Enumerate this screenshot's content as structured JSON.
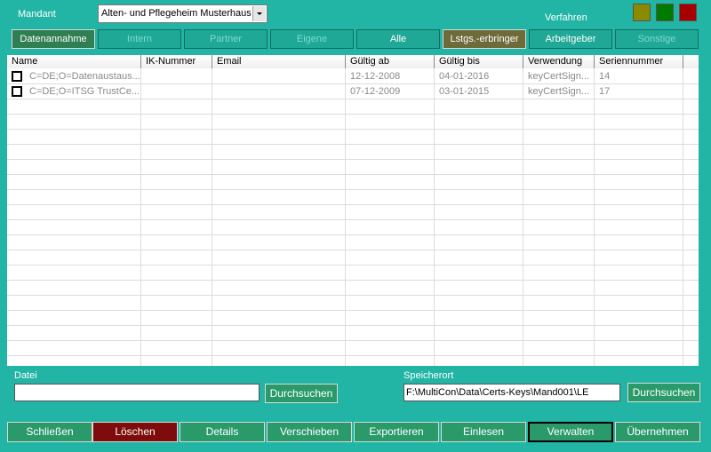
{
  "header": {
    "mandant_label": "Mandant",
    "mandant_value": "Alten- und Pflegeheim Musterhaus",
    "verfahren_label": "Verfahren",
    "status_colors": [
      "#8a8a00",
      "#007a00",
      "#a80000"
    ]
  },
  "filters": [
    {
      "label": "Datenannahme",
      "state": "active"
    },
    {
      "label": "Intern",
      "state": "disabled"
    },
    {
      "label": "Partner",
      "state": "disabled"
    },
    {
      "label": "Eigene",
      "state": "disabled"
    },
    {
      "label": "Alle",
      "state": "normal"
    },
    {
      "label": "Lstgs.-erbringer",
      "state": "selected"
    },
    {
      "label": "Arbeitgeber",
      "state": "normal"
    },
    {
      "label": "Sonstige",
      "state": "disabled"
    }
  ],
  "table": {
    "columns": [
      "Name",
      "IK-Nummer",
      "Email",
      "Gültig ab",
      "Gültig bis",
      "Verwendung",
      "Seriennummer"
    ],
    "rows": [
      {
        "name": "C=DE;O=Datenaustaus...",
        "ik": "",
        "email": "",
        "valid_from": "12-12-2008",
        "valid_to": "04-01-2016",
        "usage": "keyCertSign...",
        "serial": "14"
      },
      {
        "name": "C=DE;O=ITSG TrustCe...",
        "ik": "",
        "email": "",
        "valid_from": "07-12-2009",
        "valid_to": "03-01-2015",
        "usage": "keyCertSign...",
        "serial": "17"
      }
    ]
  },
  "datei": {
    "label": "Datei",
    "value": "",
    "button": "Durchsuchen"
  },
  "speicherort": {
    "label": "Speicherort",
    "value": "F:\\MultiCon\\Data\\Certs-Keys\\Mand001\\LE",
    "button": "Durchsuchen"
  },
  "actions": [
    {
      "label": "Schließen",
      "style": "normal"
    },
    {
      "label": "Löschen",
      "style": "danger"
    },
    {
      "label": "Details",
      "style": "normal"
    },
    {
      "label": "Verschieben",
      "style": "normal"
    },
    {
      "label": "Exportieren",
      "style": "normal"
    },
    {
      "label": "Einlesen",
      "style": "normal"
    },
    {
      "label": "Verwalten",
      "style": "focused"
    },
    {
      "label": "Übernehmen",
      "style": "normal"
    }
  ]
}
